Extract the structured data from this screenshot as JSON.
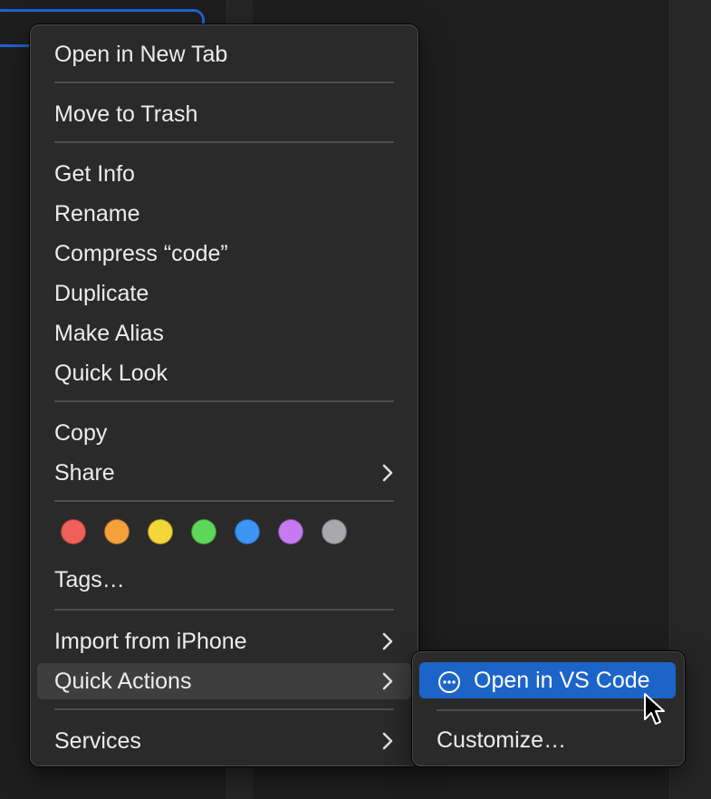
{
  "context_menu": {
    "items": {
      "open_new_tab": "Open in New Tab",
      "move_to_trash": "Move to Trash",
      "get_info": "Get Info",
      "rename": "Rename",
      "compress": "Compress “code”",
      "duplicate": "Duplicate",
      "make_alias": "Make Alias",
      "quick_look": "Quick Look",
      "copy": "Copy",
      "share": "Share",
      "tags": "Tags…",
      "import_iphone": "Import from iPhone",
      "quick_actions": "Quick Actions",
      "services": "Services"
    },
    "tag_colors": [
      {
        "name": "red",
        "color": "#f0605a"
      },
      {
        "name": "orange",
        "color": "#f5a13b"
      },
      {
        "name": "yellow",
        "color": "#f5d63a"
      },
      {
        "name": "green",
        "color": "#5ed65a"
      },
      {
        "name": "blue",
        "color": "#3d94f5"
      },
      {
        "name": "purple",
        "color": "#c57af0"
      },
      {
        "name": "gray",
        "color": "#a8a8ac"
      }
    ]
  },
  "submenu": {
    "open_vscode": "Open in VS Code",
    "open_vscode_icon": "ellipsis-circle-icon",
    "customize": "Customize…"
  },
  "colors": {
    "accent": "#1d64c9",
    "menu_background": "#2a2a2a",
    "active_item": "#3e3e3e"
  }
}
